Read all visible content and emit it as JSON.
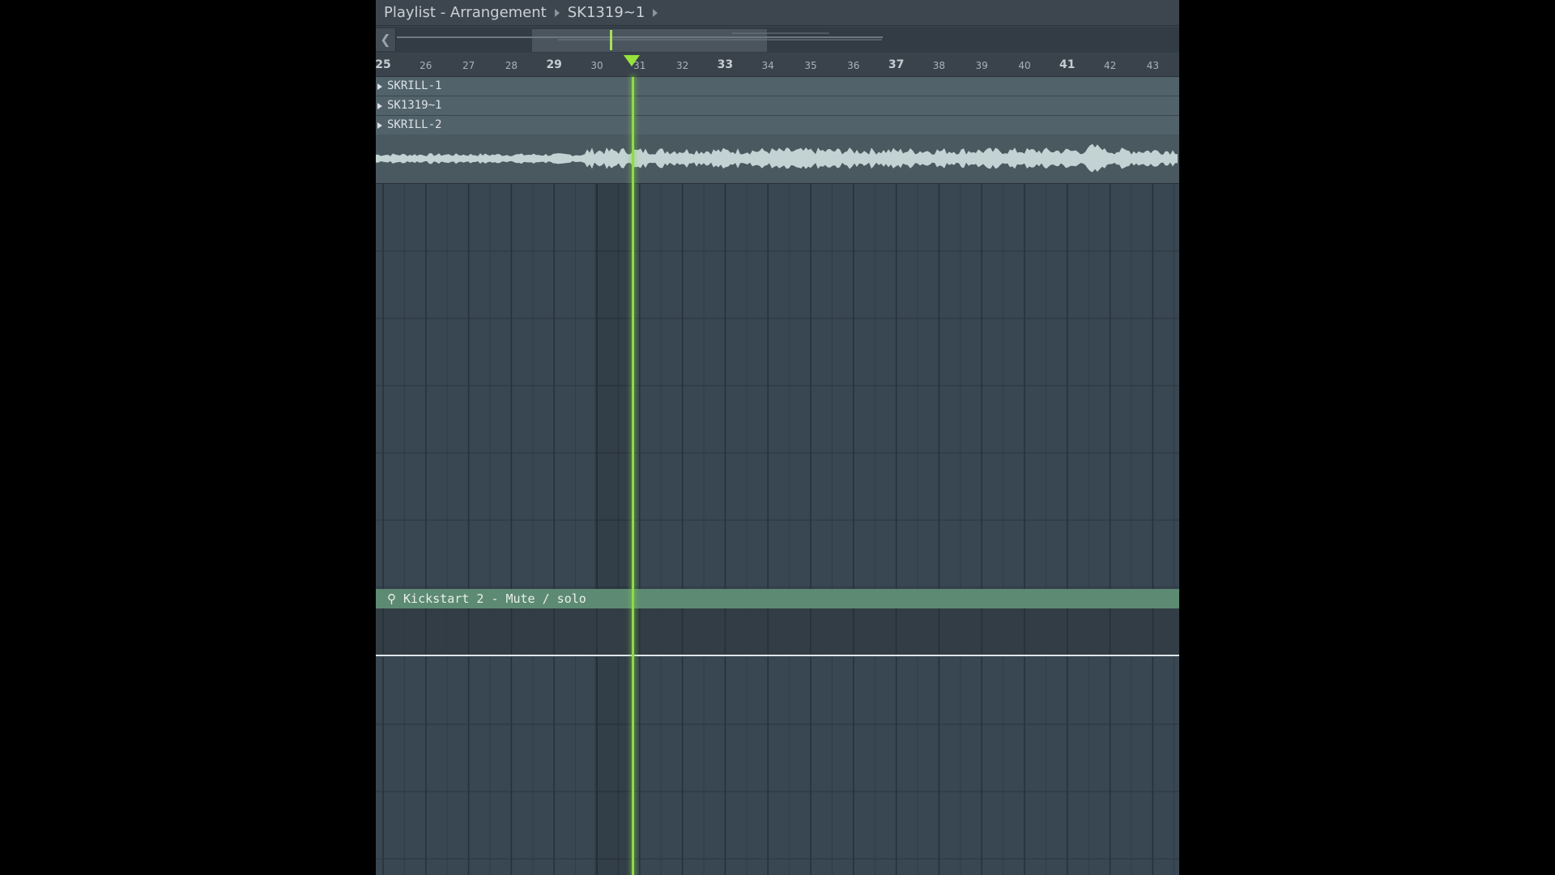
{
  "titlebar": {
    "title": "Playlist - Arrangement",
    "pattern": "SK1319~1"
  },
  "ruler": {
    "bars": [
      "25",
      "26",
      "27",
      "28",
      "29",
      "30",
      "31",
      "32",
      "33",
      "34",
      "35",
      "36",
      "37",
      "38",
      "39",
      "40",
      "41",
      "42",
      "43"
    ],
    "playhead_bar": 31
  },
  "tracks": [
    {
      "label": "SKRILL-1"
    },
    {
      "label": "SK1319~1"
    },
    {
      "label": "SKRILL-2"
    }
  ],
  "automation": {
    "label": "Kickstart 2 - Mute / solo"
  },
  "colors": {
    "accent": "#98e23c",
    "grid_bg": "#394752",
    "clip_header": "#52626a",
    "automation_header": "#5d8a72"
  },
  "icons": {
    "scroll_left": "chevron-left-icon",
    "breadcrumb_arrow": "triangle-right-icon",
    "playhead_marker": "triangle-down-icon"
  }
}
